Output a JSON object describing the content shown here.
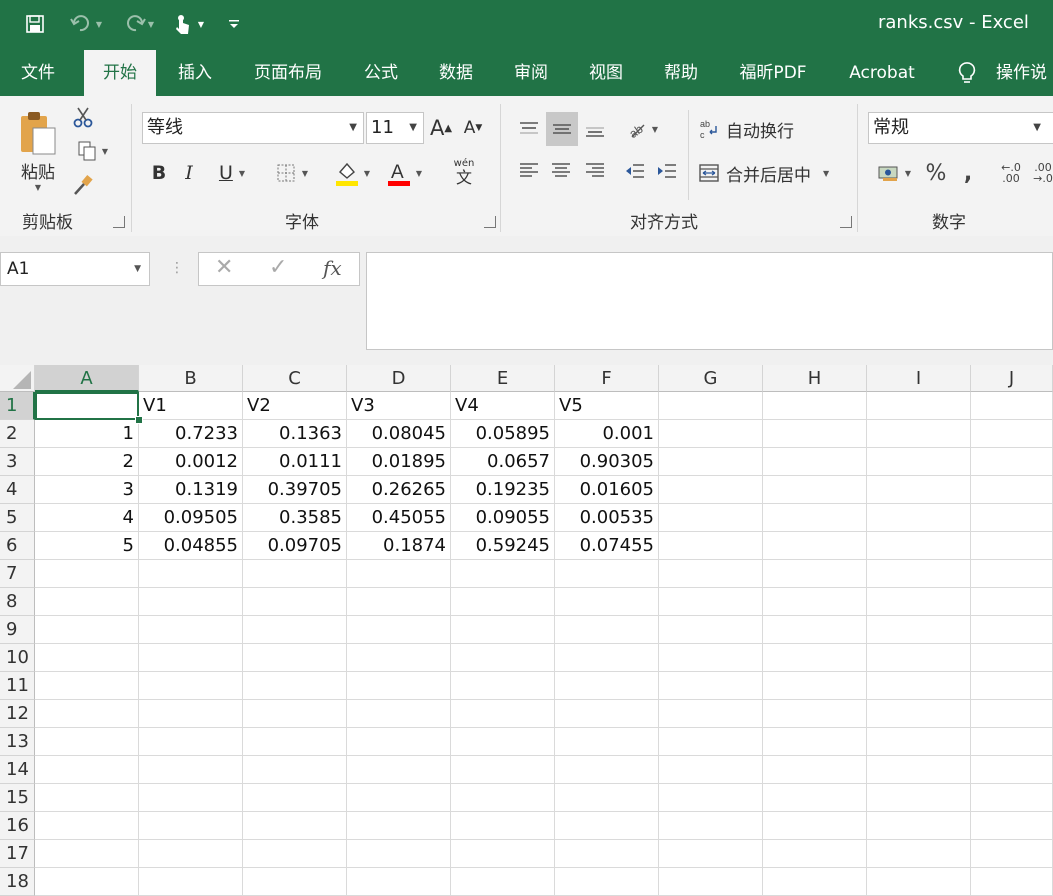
{
  "window": {
    "title": "ranks.csv  -  Excel"
  },
  "tabs": [
    "文件",
    "开始",
    "插入",
    "页面布局",
    "公式",
    "数据",
    "审阅",
    "视图",
    "帮助",
    "福昕PDF",
    "Acrobat",
    "操作说"
  ],
  "ribbon": {
    "clipboard": {
      "label": "剪贴板",
      "paste": "粘贴"
    },
    "font": {
      "label": "字体",
      "name": "等线",
      "size": "11",
      "phonetic": "wén"
    },
    "alignment": {
      "label": "对齐方式",
      "wrap": "自动换行",
      "merge": "合并后居中"
    },
    "number": {
      "label": "数字",
      "format": "常规"
    }
  },
  "formula_bar": {
    "name_box": "A1",
    "formula": ""
  },
  "sheet": {
    "columns": [
      "A",
      "B",
      "C",
      "D",
      "E",
      "F",
      "G",
      "H",
      "I",
      "J"
    ],
    "rows": [
      "1",
      "2",
      "3",
      "4",
      "5",
      "6",
      "7",
      "8",
      "9",
      "10",
      "11",
      "12",
      "13",
      "14",
      "15",
      "16",
      "17",
      "18"
    ],
    "cells": [
      [
        "",
        "V1",
        "V2",
        "V3",
        "V4",
        "V5"
      ],
      [
        "1",
        "0.7233",
        "0.1363",
        "0.08045",
        "0.05895",
        "0.001"
      ],
      [
        "2",
        "0.0012",
        "0.0111",
        "0.01895",
        "0.0657",
        "0.90305"
      ],
      [
        "3",
        "0.1319",
        "0.39705",
        "0.26265",
        "0.19235",
        "0.01605"
      ],
      [
        "4",
        "0.09505",
        "0.3585",
        "0.45055",
        "0.09055",
        "0.00535"
      ],
      [
        "5",
        "0.04855",
        "0.09705",
        "0.1874",
        "0.59245",
        "0.07455"
      ]
    ],
    "active_cell": "A1"
  },
  "colors": {
    "brand": "#217346",
    "ribbon_bg": "#f3f3f3",
    "highlight_yellow": "#ffe600",
    "font_red": "#ff0000"
  }
}
